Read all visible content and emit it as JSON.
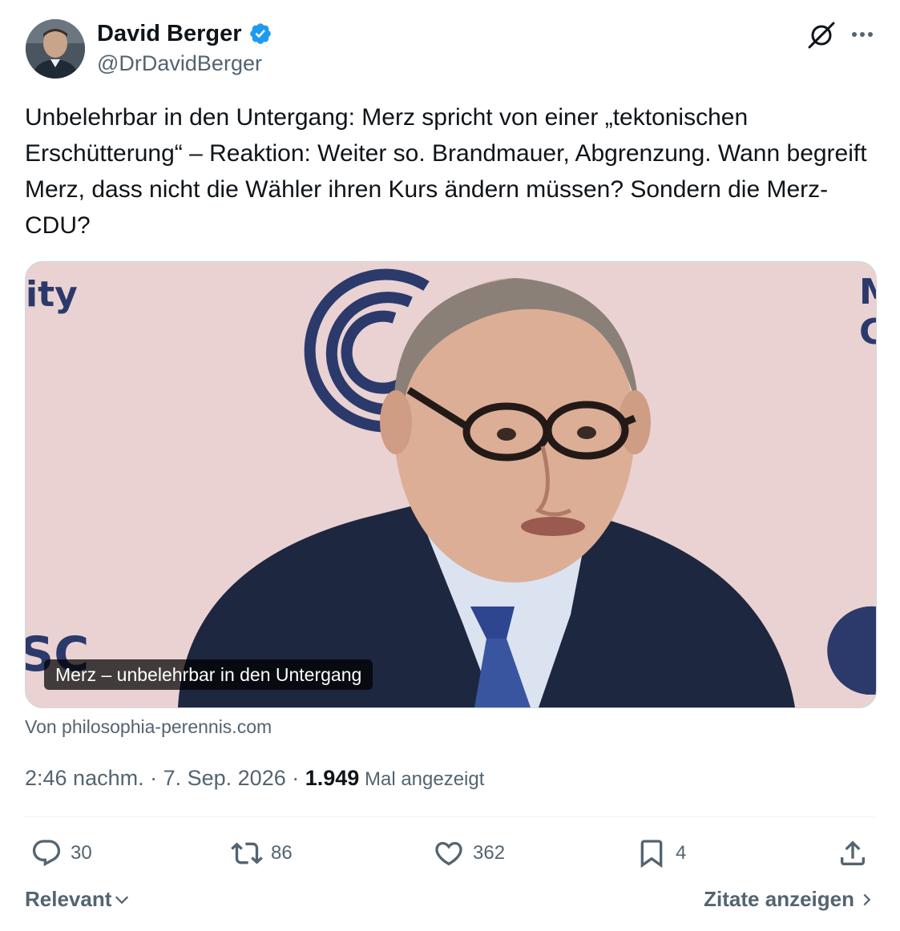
{
  "author": {
    "name": "David Berger",
    "handle": "@DrDavidBerger"
  },
  "tweet": {
    "text": "Unbelehrbar in den Untergang: Merz spricht von einer „tektonischen Erschütterung“ – Reaktion: Weiter so. Brandmauer, Abgrenzung. Wann begreift Merz, dass nicht die Wähler ihren Kurs ändern müssen? Sondern die Merz-CDU?"
  },
  "media": {
    "caption": "Merz – unbelehrbar in den Untergang",
    "backdrop_text_left": "ity",
    "backdrop_text_right_1": "M",
    "backdrop_text_right_2": "C",
    "backdrop_text_bottom_left": "SC",
    "source": "Von philosophia-perennis.com"
  },
  "meta": {
    "time": "2:46 nachm.",
    "sep1": " · ",
    "date": "7. Sep. 2026",
    "sep2": " · ",
    "views_count": "1.949",
    "views_label": " Mal angezeigt"
  },
  "actions": {
    "replies": "30",
    "reposts": "86",
    "likes": "362",
    "bookmarks": "4"
  },
  "footer": {
    "sort_label": "Relevant",
    "quotes_label": "Zitate anzeigen"
  },
  "colors": {
    "text": "#0f1419",
    "secondary": "#536471",
    "verified": "#1d9bf0",
    "border": "#cfd9de"
  },
  "icons": [
    "verified-badge-icon",
    "grok-icon",
    "more-icon",
    "reply-icon",
    "repost-icon",
    "like-icon",
    "bookmark-icon",
    "share-icon",
    "chevron-down-icon",
    "chevron-right-icon"
  ]
}
